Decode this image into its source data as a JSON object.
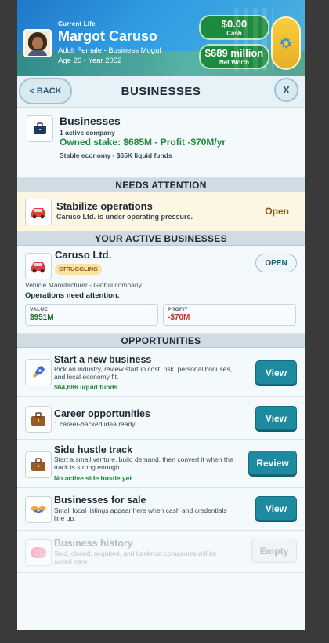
{
  "header": {
    "caption": "Current Life",
    "name": "Margot Caruso",
    "line1": "Adult Female - Business Mogul",
    "line2": "Age 26 - Year 2052",
    "cash": {
      "value": "$0.00",
      "label": "Cash"
    },
    "net_worth": {
      "value": "$689 million",
      "label": "Net Worth"
    },
    "settings_icon": "gear-icon"
  },
  "titlebar": {
    "back_label": "BACK",
    "title": "BUSINESSES",
    "close_label": "X"
  },
  "summary": {
    "title": "Businesses",
    "count": "1 active company",
    "stake": "Owned stake: $685M - Profit -$70M/yr",
    "economy": "Stable economy - $65K liquid funds",
    "icon": "briefcase-icon"
  },
  "needs_attention": {
    "header": "NEEDS ATTENTION",
    "title": "Stabilize operations",
    "desc": "Caruso Ltd. is under operating pressure.",
    "action": "Open",
    "icon": "car-icon"
  },
  "active": {
    "header": "YOUR ACTIVE BUSINESSES",
    "name": "Caruso Ltd.",
    "badge": "STRUGGLING",
    "type": "Vehicle Manufacturer - Global company",
    "ops": "Operations need attention.",
    "open_label": "OPEN",
    "value_label": "VALUE",
    "value": "$951M",
    "profit_label": "PROFIT",
    "profit": "-$70M",
    "icon": "car-icon"
  },
  "opportunities": {
    "header": "OPPORTUNITIES",
    "items": [
      {
        "title": "Start a new business",
        "desc": "Pick an industry, review startup cost, risk, personal bonuses, and local economy fit.",
        "note": "$64,686 liquid funds",
        "button": "View",
        "icon": "rocket-icon"
      },
      {
        "title": "Career opportunities",
        "desc": "1 career-backed idea ready.",
        "note": "",
        "button": "View",
        "icon": "briefcase-icon"
      },
      {
        "title": "Side hustle track",
        "desc": "Start a small venture, build demand, then convert it when the track is strong enough.",
        "note": "No active side hustle yet",
        "button": "Review",
        "icon": "briefcase-icon"
      },
      {
        "title": "Businesses for sale",
        "desc": "Small local listings appear here when cash and credentials line up.",
        "note": "",
        "button": "View",
        "icon": "handshake-icon"
      },
      {
        "title": "Business history",
        "desc": "Sold, closed, acquired, and bankrupt companies will be saved here.",
        "note": "",
        "button": "Empty",
        "icon": "brain-icon"
      }
    ]
  },
  "colors": {
    "accent": "#1e8a9f",
    "positive": "#1e8a3f",
    "negative": "#c0342b",
    "warning_bg": "#fdf6e4"
  }
}
